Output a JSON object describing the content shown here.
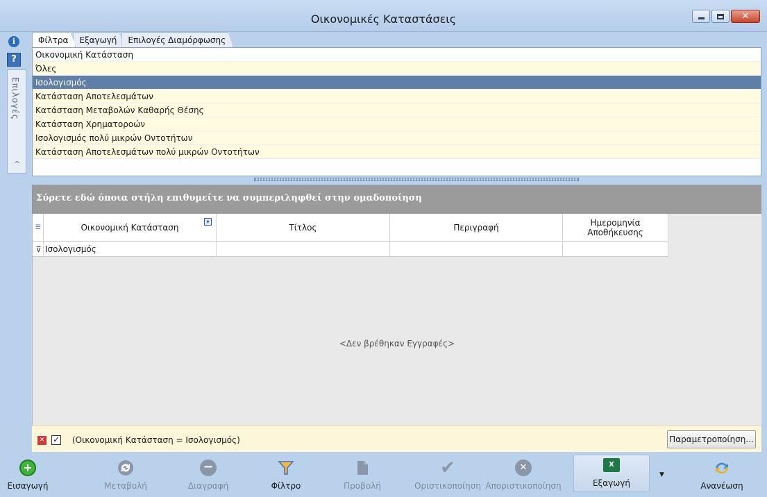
{
  "window": {
    "title": "Οικονομικές Καταστάσεις"
  },
  "side": {
    "vertical_tab_label": "Επιλογές"
  },
  "tabs": [
    {
      "label": "Φίλτρα"
    },
    {
      "label": "Εξαγωγή"
    },
    {
      "label": "Επιλογές Διαμόρφωσης"
    }
  ],
  "filter_list": {
    "header": "Οικονομική Κατάσταση",
    "items": [
      "Όλες",
      "Ισολογισμός",
      "Κατάσταση Αποτελεσμάτων",
      "Κατάσταση Μεταβολών Καθαρής Θέσης",
      "Κατάσταση Χρηματοροών",
      "Ισολογισμός πολύ μικρών Οντοτήτων",
      "Κατάσταση Αποτελεσμάτων πολύ μικρών Οντοτήτων"
    ],
    "selected_index": 1
  },
  "grid": {
    "group_panel_text": "Σύρετε εδώ όποια στήλη επιθυμείτε να συμπεριληφθεί στην ομαδοποίηση",
    "columns": [
      "Οικονομική Κατάσταση",
      "Τίτλος",
      "Περιγραφή",
      "Ημερομηνία Αποθήκευσης"
    ],
    "filter_row": [
      "Ισολογισμός",
      "",
      "",
      ""
    ],
    "empty_message": "<Δεν βρέθηκαν Εγγραφές>"
  },
  "filter_bar": {
    "expression": "(Οικονομική Κατάσταση = Ισολογισμός)",
    "checked": true,
    "button_label": "Παραμετροποίηση..."
  },
  "toolbar": {
    "add": "Εισαγωγή",
    "edit": "Μεταβολή",
    "delete": "Διαγραφή",
    "filter": "Φίλτρο",
    "view": "Προβολή",
    "finalize": "Οριστικοποίηση",
    "unfinalize": "Απoριστικοποίηση",
    "export": "Εξαγωγή",
    "refresh": "Ανανέωση"
  }
}
